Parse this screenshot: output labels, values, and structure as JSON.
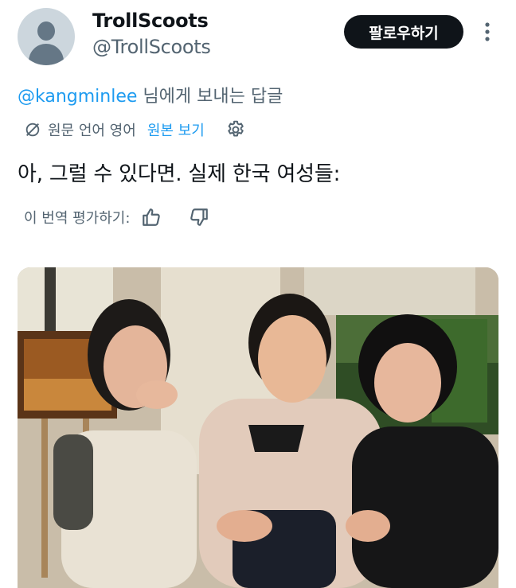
{
  "author": {
    "display_name": "TrollScoots",
    "handle": "@TrollScoots",
    "avatar_icon": "default-avatar-icon"
  },
  "follow_button_label": "팔로우하기",
  "reply": {
    "mention": "@kangminlee",
    "suffix": " 님에게 보내는 답글"
  },
  "translation": {
    "original_language": "원문 언어 영어",
    "show_original": "원본 보기",
    "globe_icon": "translate-icon",
    "settings_icon": "gear-icon"
  },
  "tweet_text": "아, 그럴 수 있다면. 실제 한국 여성들:",
  "rate": {
    "label": "이 번역 평가하기:",
    "up_icon": "thumbs-up-icon",
    "down_icon": "thumbs-down-icon"
  },
  "colors": {
    "accent": "#1d9bf0",
    "secondary_text": "#536471",
    "primary_text": "#0f1419",
    "button_bg": "#0f1419"
  }
}
